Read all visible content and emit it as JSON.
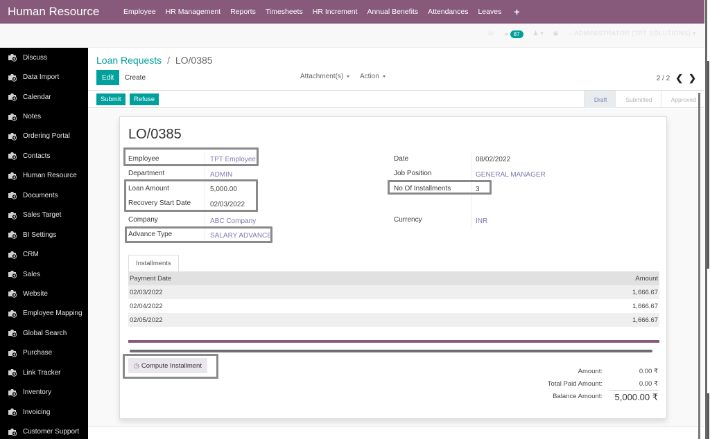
{
  "app": {
    "title": "Human Resource",
    "menu": [
      "Employee",
      "HR Management",
      "Reports",
      "Timesheets",
      "HR Increment",
      "Annual Benefits",
      "Attendances",
      "Leaves"
    ],
    "menu_add": "+",
    "brand_color": "#875a7b",
    "accent_color": "#00a09d"
  },
  "systray": {
    "messages_badge": "87",
    "user_label": "ADMINISTRATOR (TPT SOLUTIONS)"
  },
  "sidebar": {
    "items": [
      {
        "label": "Discuss",
        "icon": "app-icon"
      },
      {
        "label": "Data Import",
        "icon": "app-icon"
      },
      {
        "label": "Calendar",
        "icon": "app-icon"
      },
      {
        "label": "Notes",
        "icon": "app-icon"
      },
      {
        "label": "Ordering Portal",
        "icon": "app-icon"
      },
      {
        "label": "Contacts",
        "icon": "app-icon"
      },
      {
        "label": "Human Resource",
        "icon": "app-icon"
      },
      {
        "label": "Documents",
        "icon": "app-icon"
      },
      {
        "label": "Sales Target",
        "icon": "app-icon"
      },
      {
        "label": "BI Settings",
        "icon": "app-icon"
      },
      {
        "label": "CRM",
        "icon": "app-icon"
      },
      {
        "label": "Sales",
        "icon": "app-icon"
      },
      {
        "label": "Website",
        "icon": "app-icon"
      },
      {
        "label": "Employee Mapping",
        "icon": "app-icon"
      },
      {
        "label": "Global Search",
        "icon": "app-icon"
      },
      {
        "label": "Purchase",
        "icon": "app-icon"
      },
      {
        "label": "Link Tracker",
        "icon": "app-icon"
      },
      {
        "label": "Inventory",
        "icon": "app-icon"
      },
      {
        "label": "Invoicing",
        "icon": "app-icon"
      },
      {
        "label": "Customer Support",
        "icon": "app-icon"
      }
    ]
  },
  "control_panel": {
    "breadcrumb_parent": "Loan Requests",
    "breadcrumb_sep": "/",
    "breadcrumb_current": "LO/0385",
    "edit_label": "Edit",
    "create_label": "Create",
    "attachments_label": "Attachment(s)",
    "action_label": "Action",
    "pager": "2 / 2",
    "prev": "‹",
    "next": "›"
  },
  "statusbar": {
    "submit_label": "Submit",
    "refuse_label": "Refuse",
    "stages": [
      {
        "label": "Draft",
        "active": true
      },
      {
        "label": "Submitted",
        "active": false
      },
      {
        "label": "Approved",
        "active": false
      }
    ]
  },
  "form": {
    "name": "LO/0385",
    "left": {
      "employee_label": "Employee",
      "employee": "TPT Employee",
      "department_label": "Department",
      "department": "ADMIN",
      "loan_amount_label": "Loan Amount",
      "loan_amount": "5,000.00",
      "recovery_start_label": "Recovery Start Date",
      "recovery_start": "02/03/2022",
      "company_label": "Company",
      "company": "ABC Company",
      "advance_type_label": "Advance Type",
      "advance_type": "SALARY ADVANCE"
    },
    "right": {
      "date_label": "Date",
      "date": "08/02/2022",
      "job_position_label": "Job Position",
      "job_position": "GENERAL MANAGER",
      "installments_label": "No Of Installments",
      "installments": "3",
      "currency_label": "Currency",
      "currency": "INR"
    },
    "tab_label": "Installments",
    "table": {
      "headers": [
        "Payment Date",
        "Amount"
      ],
      "rows": [
        {
          "date": "02/03/2022",
          "amount": "1,666.67"
        },
        {
          "date": "02/04/2022",
          "amount": "1,666.67"
        },
        {
          "date": "02/05/2022",
          "amount": "1,666.67"
        }
      ]
    },
    "compute_label": "Compute Installment",
    "totals": {
      "amount_label": "Amount:",
      "amount": "0.00 ₹",
      "paid_label": "Total Paid Amount:",
      "paid": "0.00 ₹",
      "balance_label": "Balance Amount:",
      "balance": "5,000.00 ₹"
    }
  }
}
